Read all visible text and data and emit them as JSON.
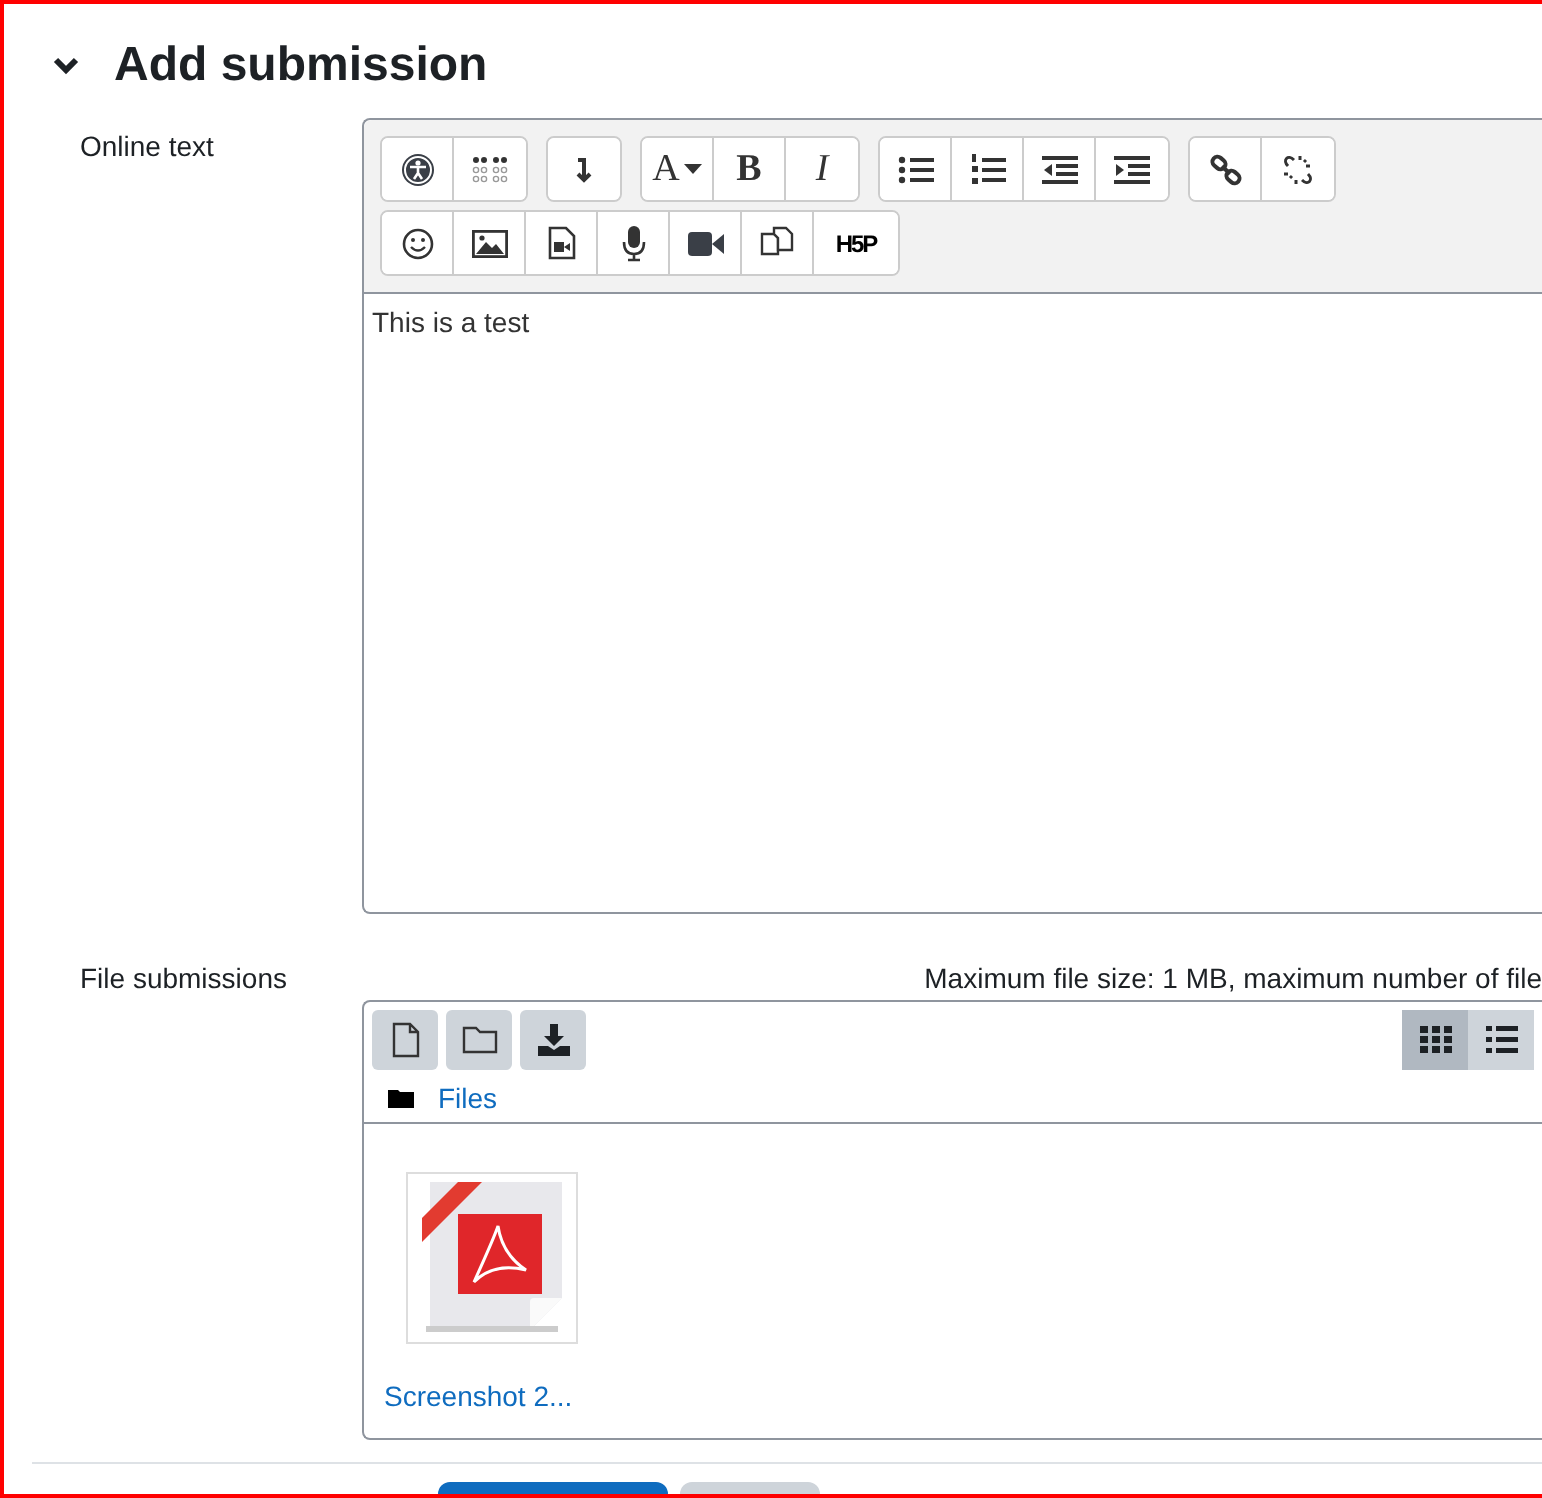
{
  "section": {
    "title": "Add submission",
    "expanded": true
  },
  "online_text": {
    "label": "Online text",
    "toolbar": [
      [
        {
          "kind": "accessibility"
        },
        {
          "kind": "braille"
        }
      ],
      [
        {
          "kind": "more"
        }
      ],
      [
        {
          "kind": "font",
          "label": "A"
        },
        {
          "kind": "bold",
          "label": "B"
        },
        {
          "kind": "italic",
          "label": "I"
        }
      ],
      [
        {
          "kind": "bullets"
        },
        {
          "kind": "numbers"
        },
        {
          "kind": "outdent"
        },
        {
          "kind": "indent"
        }
      ],
      [
        {
          "kind": "link"
        },
        {
          "kind": "unlink"
        }
      ],
      [
        {
          "kind": "emoji"
        },
        {
          "kind": "image"
        },
        {
          "kind": "media"
        },
        {
          "kind": "audio"
        },
        {
          "kind": "video"
        },
        {
          "kind": "files"
        },
        {
          "kind": "h5p",
          "label": "H5P"
        }
      ]
    ],
    "value": "This is a test"
  },
  "file_submissions": {
    "label": "File submissions",
    "limits": "Maximum file size: 1 MB, maximum number of file",
    "path": "Files",
    "views": [
      {
        "kind": "grid",
        "selected": true
      },
      {
        "kind": "list",
        "selected": false
      }
    ],
    "files": [
      {
        "name": "Screenshot 2...",
        "kind": "pdf"
      }
    ]
  }
}
